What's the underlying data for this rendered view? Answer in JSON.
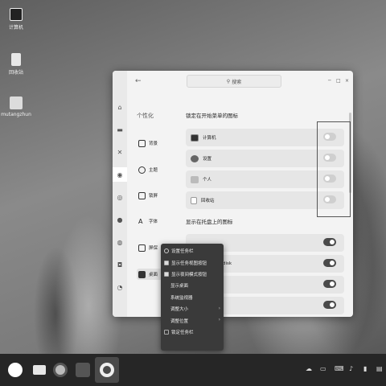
{
  "desktop": {
    "icons": [
      {
        "label": "计算机",
        "icon": "computer-icon"
      },
      {
        "label": "回收站",
        "icon": "trash-icon"
      },
      {
        "label": "mutangzhun",
        "icon": "home-folder-icon"
      }
    ]
  },
  "window": {
    "search_placeholder": "搜索",
    "controls": [
      "─",
      "□",
      "×"
    ],
    "sidebar_title": "个性化",
    "nav_items": [
      {
        "label": "背景",
        "icon": "image-icon"
      },
      {
        "label": "主题",
        "icon": "palette-icon"
      },
      {
        "label": "锁屏",
        "icon": "lock-screen-icon"
      },
      {
        "label": "字体",
        "icon": "font-icon"
      },
      {
        "label": "屏保",
        "icon": "screensaver-icon"
      },
      {
        "label": "桌面",
        "icon": "desktop-icon"
      }
    ],
    "start_menu_section": {
      "title": "锁定在开始菜单的图标",
      "items": [
        {
          "label": "计算机",
          "icon": "computer-icon",
          "enabled": false
        },
        {
          "label": "设置",
          "icon": "gear-icon",
          "enabled": false
        },
        {
          "label": "个人",
          "icon": "home-icon",
          "enabled": false
        },
        {
          "label": "回收站",
          "icon": "trash-icon",
          "enabled": false
        }
      ]
    },
    "tray_section": {
      "title": "显示在托盘上的图标",
      "items": [
        {
          "label": "",
          "enabled": true
        },
        {
          "label": "-disk",
          "enabled": true
        },
        {
          "label": "",
          "enabled": true
        },
        {
          "label": "",
          "enabled": true
        }
      ]
    }
  },
  "context_menu": {
    "items": [
      {
        "label": "设置任务栏",
        "kind": "gear"
      },
      {
        "label": "显示任务视图按钮",
        "kind": "check",
        "checked": true
      },
      {
        "label": "显示夜间模式按钮",
        "kind": "check",
        "checked": true
      },
      {
        "label": "显示桌面",
        "kind": "plain"
      },
      {
        "label": "系统监视器",
        "kind": "plain"
      },
      {
        "label": "调整大小",
        "kind": "submenu"
      },
      {
        "label": "调整位置",
        "kind": "submenu"
      },
      {
        "label": "锁定任务栏",
        "kind": "check",
        "checked": false
      }
    ]
  },
  "taskbar": {
    "apps": [
      "start-menu-icon",
      "task-view-icon",
      "firefox-icon",
      "wps-icon",
      "settings-icon"
    ],
    "tray": [
      "cloud-icon",
      "network-icon",
      "keyboard-icon",
      "volume-icon",
      "battery-icon",
      "notification-icon"
    ]
  }
}
